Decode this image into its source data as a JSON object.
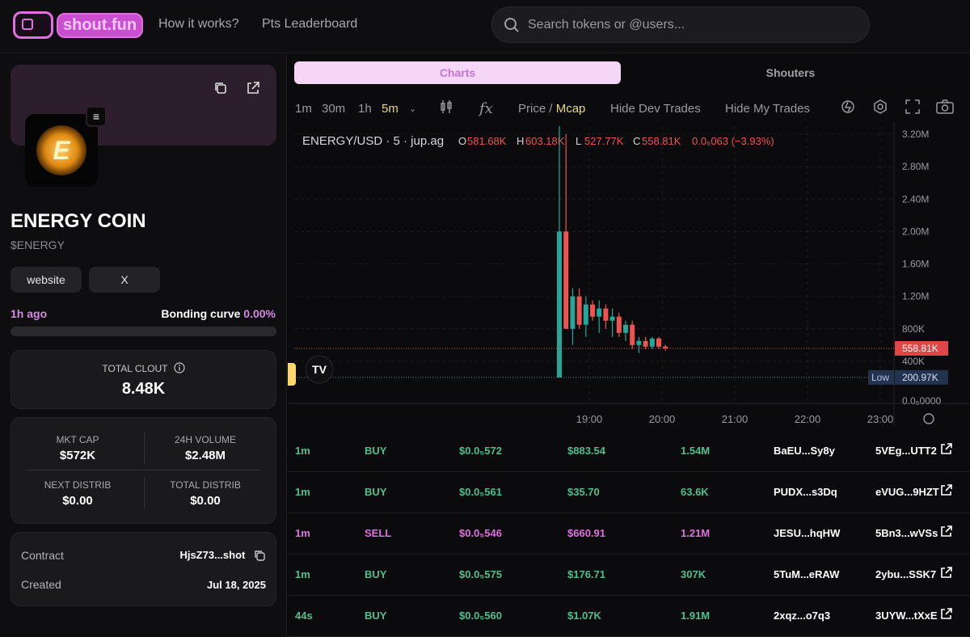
{
  "header": {
    "logo_text": "shout.fun",
    "nav": [
      "How it works?",
      "Pts Leaderboard"
    ],
    "search_placeholder": "Search tokens or @users..."
  },
  "token": {
    "name": "ENERGY COIN",
    "ticker": "$ENERGY",
    "links": [
      "website",
      "X"
    ],
    "age": "1h ago",
    "bonding_label": "Bonding curve",
    "bonding_pct": "0.00%",
    "bonding_fraction": 0.0,
    "clout_label": "TOTAL CLOUT",
    "clout_value": "8.48K",
    "stats": {
      "mkt_cap_label": "MKT CAP",
      "mkt_cap": "$572K",
      "vol_label": "24H VOLUME",
      "vol": "$2.48M",
      "next_label": "NEXT DISTRIB",
      "next": "$0.00",
      "total_label": "TOTAL DISTRIB",
      "total": "$0.00"
    },
    "contract_label": "Contract",
    "contract": "HjsZ73...shot",
    "created_label": "Created",
    "created": "Jul 18, 2025"
  },
  "tabs": {
    "charts": "Charts",
    "shouters": "Shouters"
  },
  "toolbar": {
    "intervals": [
      "1m",
      "30m",
      "1h",
      "5m"
    ],
    "active_interval": "5m",
    "price_label": "Price",
    "mcap_label": "Mcap",
    "hide_dev": "Hide Dev Trades",
    "hide_mine": "Hide My Trades"
  },
  "chart_data": {
    "type": "candlestick",
    "symbol": "ENERGY/USD · 5 · jup.ag",
    "ohlc": {
      "O": "581.68K",
      "H": "603.18K",
      "L": "527.77K",
      "C": "558.81K",
      "change": "0.0₆063 (−3.93%)"
    },
    "y_ticks": [
      "3.20M",
      "2.80M",
      "2.40M",
      "2.00M",
      "1.60M",
      "1.20M",
      "800K",
      "400K",
      "0.0₆0",
      "0.0₆0000",
      "0.0₆0000"
    ],
    "x_ticks": [
      "19:00",
      "20:00",
      "21:00",
      "22:00",
      "23:00"
    ],
    "last_price_label": "558.81K",
    "low_label": "Low",
    "low_value": "200.97K",
    "ylim": [
      0,
      3300000
    ],
    "candles": [
      {
        "o": 200000,
        "h": 3300000,
        "l": 200000,
        "c": 2000000
      },
      {
        "o": 2000000,
        "h": 3200000,
        "l": 800000,
        "c": 800000
      },
      {
        "o": 800000,
        "h": 1300000,
        "l": 600000,
        "c": 1200000
      },
      {
        "o": 1200000,
        "h": 1300000,
        "l": 800000,
        "c": 850000
      },
      {
        "o": 850000,
        "h": 1200000,
        "l": 700000,
        "c": 1100000
      },
      {
        "o": 1100000,
        "h": 1150000,
        "l": 900000,
        "c": 950000
      },
      {
        "o": 950000,
        "h": 1150000,
        "l": 750000,
        "c": 1050000
      },
      {
        "o": 1050000,
        "h": 1100000,
        "l": 800000,
        "c": 900000
      },
      {
        "o": 900000,
        "h": 1050000,
        "l": 700000,
        "c": 950000
      },
      {
        "o": 950000,
        "h": 1000000,
        "l": 700000,
        "c": 750000
      },
      {
        "o": 750000,
        "h": 900000,
        "l": 650000,
        "c": 850000
      },
      {
        "o": 850000,
        "h": 900000,
        "l": 550000,
        "c": 600000
      },
      {
        "o": 600000,
        "h": 700000,
        "l": 500000,
        "c": 650000
      },
      {
        "o": 650000,
        "h": 700000,
        "l": 550000,
        "c": 580000
      },
      {
        "o": 580000,
        "h": 700000,
        "l": 550000,
        "c": 680000
      },
      {
        "o": 680000,
        "h": 700000,
        "l": 550000,
        "c": 580000
      },
      {
        "o": 581680,
        "h": 603180,
        "l": 527770,
        "c": 558810
      }
    ]
  },
  "trades": [
    {
      "age": "1m",
      "side": "BUY",
      "price": "$0.0₅572",
      "usd": "$883.54",
      "amount": "1.54M",
      "maker": "BaEU...Sy8y",
      "tx": "5VEg...UTT2"
    },
    {
      "age": "1m",
      "side": "BUY",
      "price": "$0.0₅561",
      "usd": "$35.70",
      "amount": "63.6K",
      "maker": "PUDX...s3Dq",
      "tx": "eVUG...9HZT"
    },
    {
      "age": "1m",
      "side": "SELL",
      "price": "$0.0₅546",
      "usd": "$660.91",
      "amount": "1.21M",
      "maker": "JESU...hqHW",
      "tx": "5Bn3...wVSs"
    },
    {
      "age": "1m",
      "side": "BUY",
      "price": "$0.0₅575",
      "usd": "$176.71",
      "amount": "307K",
      "maker": "5TuM...eRAW",
      "tx": "2ybu...SSK7"
    },
    {
      "age": "44s",
      "side": "BUY",
      "price": "$0.0₅560",
      "usd": "$1.07K",
      "amount": "1.91M",
      "maker": "2xqz...o7q3",
      "tx": "3UYW...tXxE"
    }
  ],
  "colors": {
    "accent": "#d38ae0",
    "buy": "#4fbf8f",
    "sell": "#e06fe0",
    "up": "#26a69a",
    "down": "#ef5350"
  }
}
